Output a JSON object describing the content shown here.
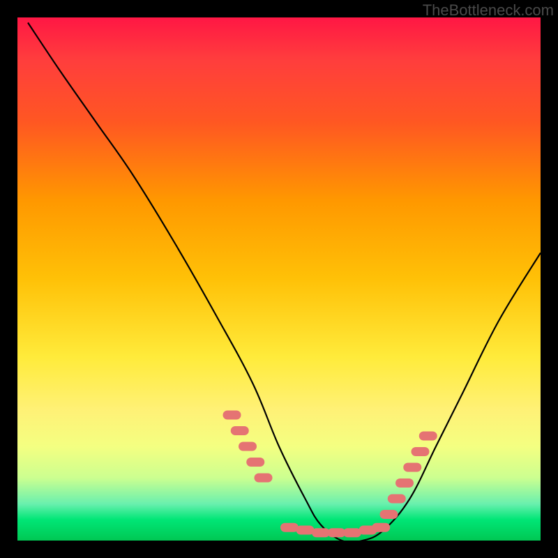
{
  "watermark": "TheBottleneck.com",
  "chart_data": {
    "type": "line",
    "title": "",
    "xlabel": "",
    "ylabel": "",
    "xlim": [
      0,
      100
    ],
    "ylim": [
      0,
      100
    ],
    "series": [
      {
        "name": "bottleneck-curve",
        "x": [
          2,
          8,
          15,
          22,
          30,
          38,
          45,
          50,
          55,
          58,
          62,
          66,
          70,
          75,
          80,
          85,
          92,
          100
        ],
        "values": [
          99,
          90,
          80,
          70,
          57,
          43,
          30,
          18,
          8,
          3,
          0,
          0,
          2,
          8,
          18,
          28,
          42,
          55
        ]
      }
    ],
    "markers": {
      "name": "highlighted-points",
      "color": "#e57373",
      "points": [
        {
          "x": 41,
          "y": 24
        },
        {
          "x": 42.5,
          "y": 21
        },
        {
          "x": 44,
          "y": 18
        },
        {
          "x": 45.5,
          "y": 15
        },
        {
          "x": 47,
          "y": 12
        },
        {
          "x": 52,
          "y": 2.5
        },
        {
          "x": 55,
          "y": 2
        },
        {
          "x": 58,
          "y": 1.5
        },
        {
          "x": 61,
          "y": 1.5
        },
        {
          "x": 64,
          "y": 1.5
        },
        {
          "x": 67,
          "y": 2
        },
        {
          "x": 69.5,
          "y": 2.5
        },
        {
          "x": 71,
          "y": 5
        },
        {
          "x": 72.5,
          "y": 8
        },
        {
          "x": 74,
          "y": 11
        },
        {
          "x": 75.5,
          "y": 14
        },
        {
          "x": 77,
          "y": 17
        },
        {
          "x": 78.5,
          "y": 20
        }
      ]
    },
    "gradient_stops": [
      {
        "pos": 0,
        "color": "#ff1744"
      },
      {
        "pos": 50,
        "color": "#ffeb3b"
      },
      {
        "pos": 100,
        "color": "#00c853"
      }
    ]
  }
}
